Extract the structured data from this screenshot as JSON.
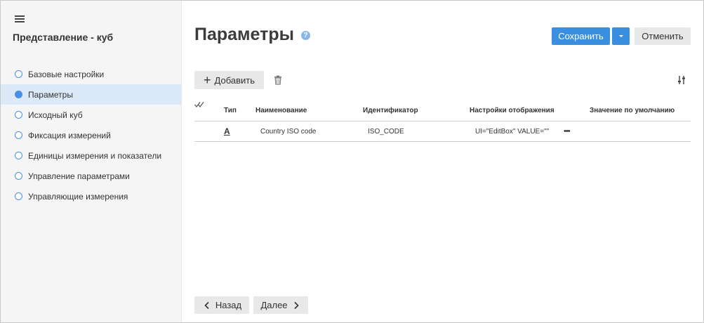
{
  "sidebar": {
    "title": "Представление - куб",
    "steps": [
      {
        "label": "Базовые настройки",
        "active": false
      },
      {
        "label": "Параметры",
        "active": true
      },
      {
        "label": "Исходный куб",
        "active": false
      },
      {
        "label": "Фиксация измерений",
        "active": false
      },
      {
        "label": "Единицы измерения и показатели",
        "active": false
      },
      {
        "label": "Управление параметрами",
        "active": false
      },
      {
        "label": "Управляющие измерения",
        "active": false
      }
    ]
  },
  "header": {
    "title": "Параметры",
    "help_label": "?",
    "save_label": "Сохранить",
    "cancel_label": "Отменить"
  },
  "toolbar": {
    "add_label": "Добавить"
  },
  "table": {
    "columns": {
      "type": "Тип",
      "name": "Наименование",
      "id": "Идентификатор",
      "display": "Настройки отображения",
      "default": "Значение по умолчанию"
    },
    "rows": [
      {
        "type_glyph": "A",
        "name": "Country ISO code",
        "id": "ISO_CODE",
        "display": "UI=\"EditBox\" VALUE=\"\"",
        "more": "•••",
        "default": ""
      }
    ]
  },
  "footer": {
    "back_label": "Назад",
    "next_label": "Далее"
  },
  "colors": {
    "accent": "#3b8fe0",
    "active_step_bg": "#dbe9f8",
    "sidebar_bg": "#f5f5f5",
    "button_bg": "#e8e8e8"
  }
}
